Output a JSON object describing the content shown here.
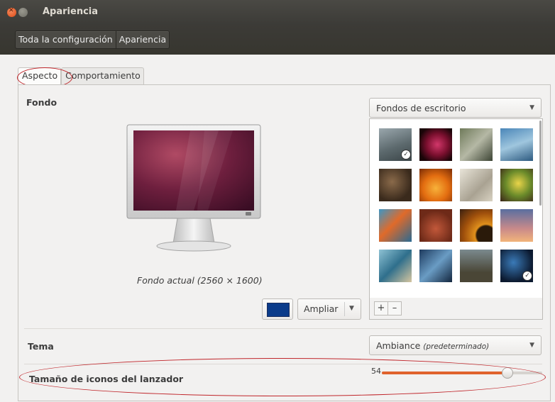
{
  "window": {
    "title": "Apariencia"
  },
  "breadcrumb": {
    "all_settings": "Toda la configuración",
    "current": "Apariencia"
  },
  "tabs": [
    {
      "label": "Aspecto"
    },
    {
      "label": "Comportamiento"
    }
  ],
  "background": {
    "heading": "Fondo",
    "source_dropdown": "Fondos de escritorio",
    "caption": "Fondo actual (2560 × 1600)",
    "color_hex": "#0b3b8a",
    "zoom_label": "Ampliar",
    "add_label": "+",
    "remove_label": "–"
  },
  "theme": {
    "heading": "Tema",
    "value": "Ambiance",
    "value_note": "(predeterminado)"
  },
  "launcher": {
    "heading": "Tamaño de iconos del lanzador",
    "value_label": "54",
    "fraction": 0.78
  }
}
